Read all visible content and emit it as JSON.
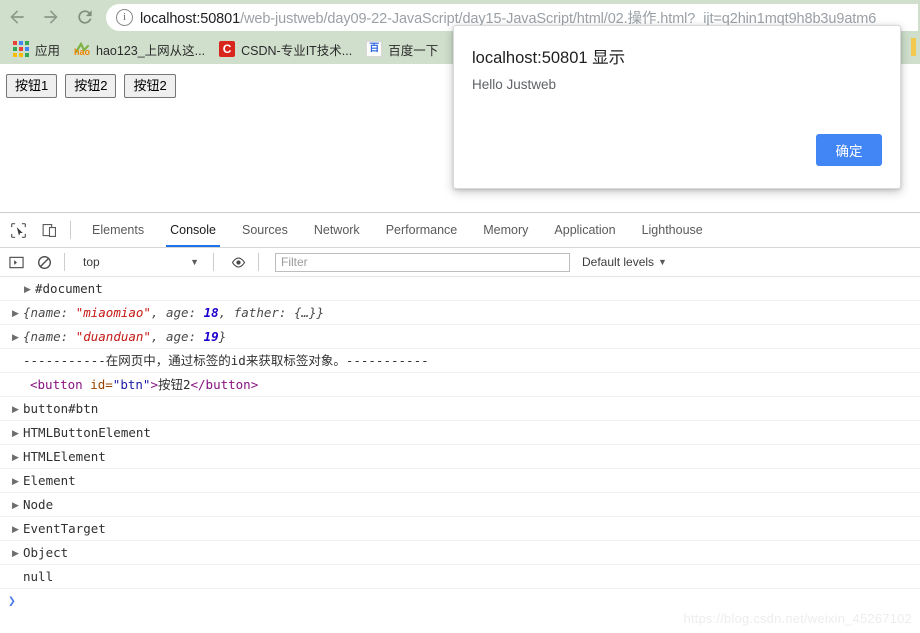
{
  "browser": {
    "nav": {
      "back_label": "←",
      "forward_label": "→",
      "reload_label": "⟳"
    },
    "omnibox": {
      "info_icon_label": "i",
      "url_host": "localhost:50801",
      "url_path": "/web-justweb/day09-22-JavaScript/day15-JavaScript/html/02.操作.html?_ijt=q2hin1mqt9h8b3u9atm6"
    },
    "bookmarks": [
      {
        "label": "应用",
        "icon": "apps-grid-icon"
      },
      {
        "label": "hao123_上网从这...",
        "icon": "hao123-icon",
        "icon_text": "hao"
      },
      {
        "label": "CSDN-专业IT技术...",
        "icon": "csdn-icon",
        "icon_text": "C"
      },
      {
        "label": "百度一下",
        "icon": "baidu-icon",
        "icon_text": "百"
      }
    ]
  },
  "page": {
    "buttons": [
      {
        "label": "按钮1"
      },
      {
        "label": "按钮2"
      },
      {
        "label": "按钮2"
      }
    ]
  },
  "dialog": {
    "title": "localhost:50801 显示",
    "message": "Hello Justweb",
    "ok_label": "确定",
    "accent_color": "#4285f4"
  },
  "devtools": {
    "tool_icons": [
      {
        "name": "inspect-element-icon"
      },
      {
        "name": "device-toolbar-icon"
      }
    ],
    "tabs": [
      {
        "label": "Elements",
        "active": false
      },
      {
        "label": "Console",
        "active": true
      },
      {
        "label": "Sources",
        "active": false
      },
      {
        "label": "Network",
        "active": false
      },
      {
        "label": "Performance",
        "active": false
      },
      {
        "label": "Memory",
        "active": false
      },
      {
        "label": "Application",
        "active": false
      },
      {
        "label": "Lighthouse",
        "active": false
      }
    ],
    "active_tab_underline_color": "#1a73e8",
    "console_toolbar": {
      "execute_icon": "console-sidebar-icon",
      "clear_icon": "clear-console-icon",
      "context_value": "top",
      "eye_icon": "live-expression-icon",
      "filter_placeholder": "Filter",
      "filter_value": "",
      "levels_label": "Default levels"
    },
    "console_rows": [
      {
        "kind": "simple",
        "expandable": true,
        "extra_indent": true,
        "text": "#document"
      },
      {
        "kind": "object",
        "expandable": true,
        "parts": [
          {
            "t": "{name: ",
            "c": "obj"
          },
          {
            "t": "\"miaomiao\"",
            "c": "str"
          },
          {
            "t": ", age: ",
            "c": "obj"
          },
          {
            "t": "18",
            "c": "num"
          },
          {
            "t": ", father: {…}}",
            "c": "obj"
          }
        ]
      },
      {
        "kind": "object",
        "expandable": true,
        "parts": [
          {
            "t": "{name: ",
            "c": "obj"
          },
          {
            "t": "\"duanduan\"",
            "c": "str"
          },
          {
            "t": ", age: ",
            "c": "obj"
          },
          {
            "t": "19",
            "c": "num"
          },
          {
            "t": "}",
            "c": "obj"
          }
        ]
      },
      {
        "kind": "simple",
        "expandable": false,
        "text": "-----------在网页中，通过标签的id来获取标签对象。-----------"
      },
      {
        "kind": "html",
        "expandable": false,
        "parts": [
          {
            "t": "<button",
            "c": "tag-p"
          },
          {
            "t": " id=",
            "c": "tag-attr"
          },
          {
            "t": "\"btn\"",
            "c": "tag-val"
          },
          {
            "t": ">",
            "c": "tag-p"
          },
          {
            "t": "按钮2",
            "c": "tag-txt"
          },
          {
            "t": "</button>",
            "c": "tag-p"
          }
        ]
      },
      {
        "kind": "simple",
        "expandable": true,
        "text": "button#btn"
      },
      {
        "kind": "simple",
        "expandable": true,
        "text": "HTMLButtonElement"
      },
      {
        "kind": "simple",
        "expandable": true,
        "text": "HTMLElement"
      },
      {
        "kind": "simple",
        "expandable": true,
        "text": "Element"
      },
      {
        "kind": "simple",
        "expandable": true,
        "text": "Node"
      },
      {
        "kind": "simple",
        "expandable": true,
        "text": "EventTarget"
      },
      {
        "kind": "simple",
        "expandable": true,
        "text": "Object"
      },
      {
        "kind": "simple",
        "expandable": false,
        "text": "null"
      }
    ],
    "prompt_symbol": "❯"
  },
  "watermark": "https://blog.csdn.net/weixin_45267102"
}
